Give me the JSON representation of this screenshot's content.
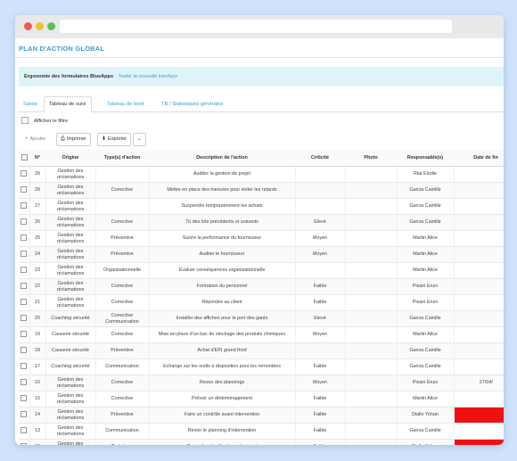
{
  "header": {
    "title": "PLAN D'ACTION GLOBAL"
  },
  "notice": {
    "text": "Ergonomie des formulaires BlueApps",
    "link": "Tester la nouvelle interface"
  },
  "tabs": [
    {
      "label": "Saisie"
    },
    {
      "label": "Tableau de suivi"
    },
    {
      "label": "Tableau de bord"
    },
    {
      "label": "TB / Statistiques générales"
    }
  ],
  "filter": {
    "label": "Afficher le filtre"
  },
  "toolbar": {
    "add": "Ajouter",
    "print": "Imprimer",
    "export": "Exporter",
    "dropdown": "⌄"
  },
  "table": {
    "columns": [
      "N°",
      "Origine",
      "Type(s) d'action",
      "Description de l'action",
      "Criticité",
      "Photo",
      "Responsable(s)",
      "Date de fin"
    ],
    "rows": [
      {
        "num": "29",
        "origine": "Gestion des réclamations",
        "type": "",
        "desc": "Auditer la gestion de projet",
        "crit": "",
        "resp": "Riat Elodie",
        "date": ""
      },
      {
        "num": "28",
        "origine": "Gestion des réclamations",
        "type": "Corrective",
        "desc": "Mettre en place des mesures pour éviter les retards",
        "crit": "",
        "resp": "Garcia Camille",
        "date": ""
      },
      {
        "num": "27",
        "origine": "Gestion des réclamations",
        "type": "",
        "desc": "Suspendre temporairement les achats",
        "crit": "",
        "resp": "Garcia Camille",
        "date": ""
      },
      {
        "num": "26",
        "origine": "Gestion des réclamations",
        "type": "Corrective",
        "desc": "Tri des lots précédents et suivants",
        "crit": "Elevé",
        "resp": "Garcia Camille",
        "date": ""
      },
      {
        "num": "25",
        "origine": "Gestion des réclamations",
        "type": "Préventive",
        "desc": "Suivre la performance du fournisseur",
        "crit": "Moyen",
        "resp": "Martin Alice",
        "date": ""
      },
      {
        "num": "24",
        "origine": "Gestion des réclamations",
        "type": "Préventive",
        "desc": "Auditer le fournisseur",
        "crit": "Moyen",
        "resp": "Martin Alice",
        "date": ""
      },
      {
        "num": "23",
        "origine": "Gestion des réclamations",
        "type": "Organisationnelle",
        "desc": "Evaluer conséquences organisationnelle",
        "crit": "",
        "resp": "Martin Alice",
        "date": ""
      },
      {
        "num": "22",
        "origine": "Gestion des réclamations",
        "type": "Corrective",
        "desc": "Formation du personnel",
        "crit": "Faible",
        "resp": "Pisani Enzo",
        "date": ""
      },
      {
        "num": "21",
        "origine": "Gestion des réclamations",
        "type": "Corrective",
        "desc": "Répondre au client",
        "crit": "Faible",
        "resp": "Pisani Enzo",
        "date": ""
      },
      {
        "num": "20",
        "origine": "Coaching sécurité",
        "type": "Corrective Communication",
        "desc": "Installer des affiches pour le port des gants",
        "crit": "Elevé",
        "resp": "Garcia Camille",
        "date": ""
      },
      {
        "num": "19",
        "origine": "Causerie sécurité",
        "type": "Corrective",
        "desc": "Mise en place d'un bac de stockage des produits chimiques",
        "crit": "Moyen",
        "resp": "Martin Alice",
        "date": ""
      },
      {
        "num": "18",
        "origine": "Causerie sécurité",
        "type": "Préventive",
        "desc": "Achat d'EPI grand froid",
        "crit": "",
        "resp": "Garcia Camille",
        "date": ""
      },
      {
        "num": "17",
        "origine": "Coaching sécurité",
        "type": "Communication",
        "desc": "Echange sur les outils à disposition pour les remontées",
        "crit": "Faible",
        "resp": "Garcia Camille",
        "date": ""
      },
      {
        "num": "16",
        "origine": "Gestion des réclamations",
        "type": "Corrective",
        "desc": "Revue des plannings",
        "crit": "Moyen",
        "resp": "Pisani Enzo",
        "date": "27/04/"
      },
      {
        "num": "15",
        "origine": "Gestion des réclamations",
        "type": "Corrective",
        "desc": "Prévoir un dédommagement",
        "crit": "Faible",
        "resp": "Martin Alice",
        "date": ""
      },
      {
        "num": "14",
        "origine": "Gestion des réclamations",
        "type": "Préventive",
        "desc": "Faire un contrôle avant intervention",
        "crit": "Faible",
        "resp": "Diallo Yohan",
        "date": ""
      },
      {
        "num": "13",
        "origine": "Gestion des réclamations",
        "type": "Communication",
        "desc": "Revoir le planning d'intervention",
        "crit": "Faible",
        "resp": "Garcia Camille",
        "date": ""
      },
      {
        "num": "12",
        "origine": "Gestion des réclamations",
        "type": "Technique",
        "desc": "Revoir les planifications de projet",
        "crit": "Faible",
        "resp": "Diallo Yohan",
        "date": ""
      }
    ]
  },
  "colors": {
    "accent": "#3e9bd2",
    "overdue": "#ee1111",
    "notice_bg": "#dff4f8"
  }
}
